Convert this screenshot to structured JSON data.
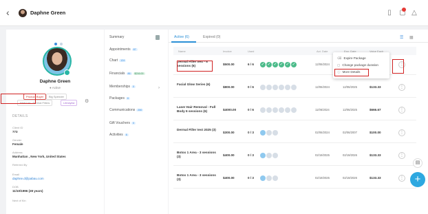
{
  "header": {
    "back_icon": "chevron-left-icon",
    "client_name": "Daphne Green",
    "icons": [
      "phone-icon",
      "message-icon",
      "warning-icon"
    ]
  },
  "profile": {
    "name": "Daphne Green",
    "status": "● Active",
    "tags": [
      "Product Buyer",
      "Big Spender",
      "Wait List : Dermal Fillers",
      "Lifestylist"
    ],
    "details_heading": "DETAILS",
    "fields": [
      {
        "label": "Client ID",
        "value": "773"
      },
      {
        "label": "Gender",
        "value": "Female"
      },
      {
        "label": "Address",
        "value": "Manhattan , New York, United States"
      },
      {
        "label": "Referred By",
        "value": ""
      },
      {
        "label": "Email",
        "value": "daphne.d@pabau.com"
      },
      {
        "label": "DOB",
        "value": "11/10/1996 (28 years)"
      },
      {
        "label": "Next of Kin",
        "value": ""
      }
    ]
  },
  "nav": {
    "items": [
      {
        "label": "Summary",
        "badge": ""
      },
      {
        "label": "Appointments",
        "badge": "87"
      },
      {
        "label": "Chart",
        "badge": "124"
      },
      {
        "label": "Financials",
        "badge": "86",
        "badge2": "$216.00"
      },
      {
        "label": "Memberships",
        "badge": "0"
      },
      {
        "label": "Packages",
        "badge": "6"
      },
      {
        "label": "Communications",
        "badge": "250"
      },
      {
        "label": "Gift Vouchers",
        "badge": "0"
      },
      {
        "label": "Activities",
        "badge": "6"
      }
    ]
  },
  "tabs": {
    "active": "Active (6)",
    "expired": "Expired (0)"
  },
  "table": {
    "headers": [
      "Name",
      "Invoice",
      "Used",
      "Act. Date",
      "Exp. Date",
      "Value Each"
    ],
    "rows": [
      {
        "name": "Dermal Filler test - 6 sessions (6)",
        "invoice": "$500.00",
        "used": "6 / 6",
        "done": 6,
        "total": 6,
        "act": "12/06/2024",
        "exp": "",
        "each": ""
      },
      {
        "name": "Facial Glow Series (6)",
        "invoice": "$800.00",
        "used": "0 / 6",
        "done": 0,
        "total": 6,
        "act": "12/06/2024",
        "exp": "12/06/2025",
        "each": "$133.33"
      },
      {
        "name": "Laser Hair Removal - Full Body 6 sessions (6)",
        "invoice": "$4000.00",
        "used": "0 / 6",
        "done": 0,
        "total": 6,
        "act": "11/06/2024",
        "exp": "12/06/2025",
        "each": "$666.67"
      },
      {
        "name": "Dermal Filler test 2025 (3)",
        "invoice": "$300.00",
        "used": "0 / 3",
        "done": 0,
        "total": 3,
        "act": "02/06/2024",
        "exp": "02/06/2007",
        "each": "$100.00"
      },
      {
        "name": "Botox 1 Area - 3 sessions (3)",
        "invoice": "$400.00",
        "used": "0 / 3",
        "done": 0,
        "total": 3,
        "act": "02/19/2025",
        "exp": "02/19/2026",
        "each": "$133.33"
      },
      {
        "name": "Botox 1 Area - 3 sessions (3)",
        "invoice": "$400.00",
        "used": "0 / 3",
        "done": 0,
        "total": 3,
        "act": "02/19/2025",
        "exp": "02/19/2026",
        "each": "$133.33"
      }
    ]
  },
  "context_menu": {
    "items": [
      "Expire Package",
      "Change package duration",
      "More Details"
    ]
  },
  "colors": {
    "accent": "#2a8fd6",
    "highlight": "#d02020",
    "success": "#4cbb8a"
  }
}
